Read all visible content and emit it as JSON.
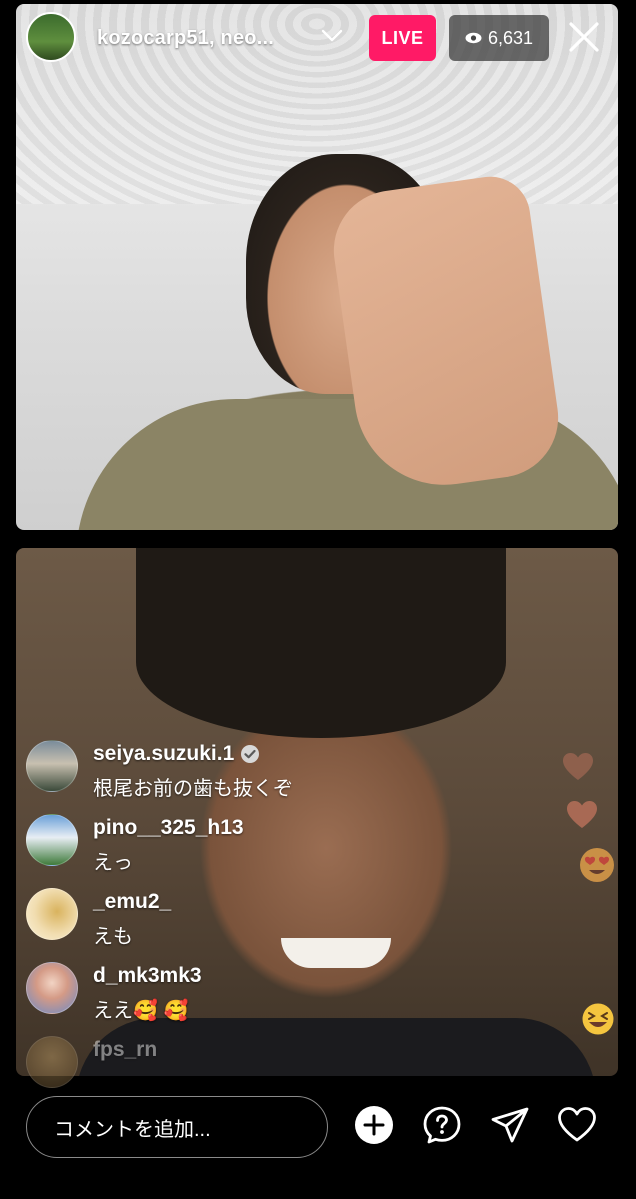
{
  "header": {
    "host_names": "kozocarp51, neo...",
    "live_label": "LIVE",
    "viewer_count": "6,631",
    "icons": {
      "avatar": "host-avatar",
      "dropdown": "chevron-down-icon",
      "viewers": "eye-icon",
      "close": "close-icon"
    }
  },
  "comments": [
    {
      "username": "seiya.suzuki.1",
      "verified": true,
      "text": "根尾お前の歯も抜くぞ"
    },
    {
      "username": "pino__325_h13",
      "verified": false,
      "text": "えっ"
    },
    {
      "username": "_emu2_",
      "verified": false,
      "text": "えも"
    },
    {
      "username": "d_mk3mk3",
      "verified": false,
      "text": "ええ🥰 🥰"
    },
    {
      "username": "fps_rn",
      "verified": false,
      "text": ""
    }
  ],
  "reactions": [
    "heart",
    "heart",
    "heart-eyes-emoji",
    "laughing-emoji"
  ],
  "bottom_bar": {
    "comment_placeholder": "コメントを追加...",
    "icons": [
      "add-icon",
      "question-icon",
      "send-icon",
      "heart-icon"
    ]
  },
  "colors": {
    "live_badge": "#ff1a66",
    "background": "#000000"
  }
}
